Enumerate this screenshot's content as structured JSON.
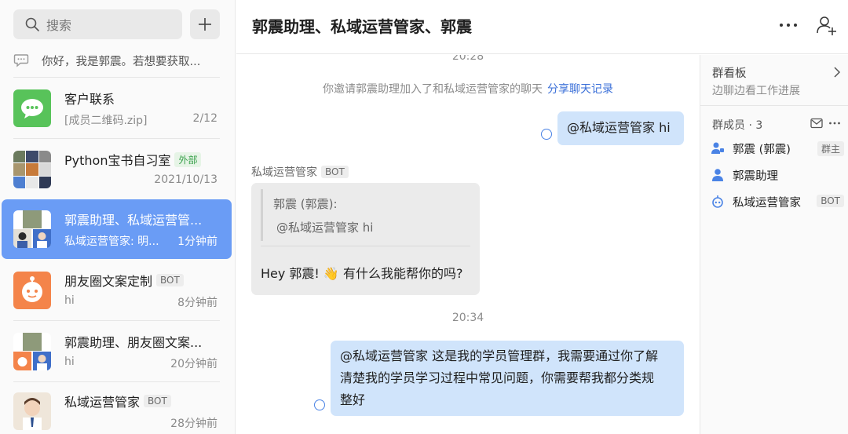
{
  "sidebar": {
    "search_placeholder": "搜索",
    "top_preview": "你好，我是郭震。若想要获取...",
    "conversations": [
      {
        "name": "客户联系",
        "tag": "",
        "subtitle": "[成员二维码.zip]",
        "time": "2/12"
      },
      {
        "name": "Python宝书自习室",
        "tag": "外部",
        "subtitle": "",
        "time": "2021/10/13"
      },
      {
        "name": "郭震助理、私域运营管...",
        "tag": "",
        "subtitle": "私域运营管家: 明...",
        "time": "1分钟前"
      },
      {
        "name": "朋友圈文案定制",
        "tag": "BOT",
        "subtitle": "hi",
        "time": "8分钟前"
      },
      {
        "name": "郭震助理、朋友圈文案...",
        "tag": "",
        "subtitle": "hi",
        "time": "20分钟前"
      },
      {
        "name": "私域运营管家",
        "tag": "BOT",
        "subtitle": "",
        "time": "28分钟前"
      }
    ]
  },
  "header": {
    "title": "郭震助理、私域运营管家、郭震"
  },
  "chat": {
    "top_time": "20:28",
    "system_message": "你邀请郭震助理加入了和私域运营管家的聊天",
    "system_link": "分享聊天记录",
    "msg1": "@私域运营管家 hi",
    "bot_sender": "私域运营管家",
    "bot_tag": "BOT",
    "quote_author": "郭震 (郭震):",
    "quote_text": "@私域运营管家 hi",
    "bot_reply": "Hey 郭震! 👋 有什么我能帮你的吗?",
    "time2": "20:34",
    "msg2_line1": "@私域运营管家 这是我的学员管理群，我需要通过你了解",
    "msg2_line2": "清楚我的学员学习过程中常见问题，你需要帮我都分类规",
    "msg2_line3": "整好"
  },
  "right_panel": {
    "board_title": "群看板",
    "board_subtitle": "边聊边看工作进展",
    "members_title": "群成员 · 3",
    "members": [
      {
        "name": "郭震 (郭震)",
        "tag": "群主"
      },
      {
        "name": "郭震助理",
        "tag": ""
      },
      {
        "name": "私域运营管家",
        "tag": "BOT"
      }
    ]
  },
  "colors": {
    "accent": "#6a9cf5",
    "outgoing_bubble": "#d0e4fb",
    "incoming_bubble": "#ebebeb",
    "link": "#3a6fd8",
    "external_tag": "#3aa14c"
  }
}
